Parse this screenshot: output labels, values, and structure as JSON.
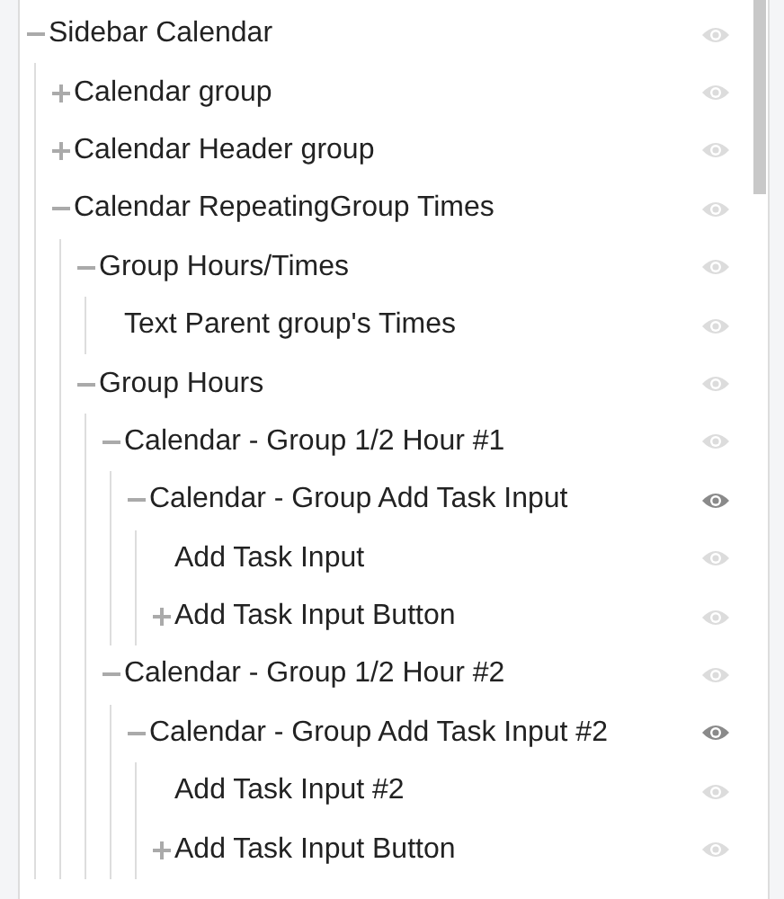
{
  "tree": [
    {
      "label": "Sidebar Calendar",
      "expanded": true,
      "eye_dark": false,
      "children": [
        {
          "label": "Calendar group",
          "expanded": false,
          "eye_dark": false
        },
        {
          "label": "Calendar Header group",
          "expanded": false,
          "eye_dark": false
        },
        {
          "label": "Calendar RepeatingGroup Times",
          "expanded": true,
          "eye_dark": false,
          "children": [
            {
              "label": "Group Hours/Times",
              "expanded": true,
              "eye_dark": false,
              "children": [
                {
                  "label": "Text Parent group's Times",
                  "eye_dark": false
                }
              ]
            },
            {
              "label": "Group Hours",
              "expanded": true,
              "eye_dark": false,
              "children": [
                {
                  "label": "Calendar - Group 1/2 Hour #1",
                  "expanded": true,
                  "eye_dark": false,
                  "children": [
                    {
                      "label": "Calendar - Group Add Task Input",
                      "expanded": true,
                      "eye_dark": true,
                      "children": [
                        {
                          "label": "Add Task Input",
                          "eye_dark": false
                        },
                        {
                          "label": "Add Task Input Button",
                          "expanded": false,
                          "eye_dark": false
                        }
                      ]
                    }
                  ]
                },
                {
                  "label": "Calendar - Group 1/2 Hour #2",
                  "expanded": true,
                  "eye_dark": false,
                  "children": [
                    {
                      "label": "Calendar - Group Add Task Input #2",
                      "expanded": true,
                      "eye_dark": true,
                      "children": [
                        {
                          "label": "Add Task Input #2",
                          "eye_dark": false
                        },
                        {
                          "label": "Add Task Input Button",
                          "expanded": false,
                          "eye_dark": false
                        }
                      ]
                    }
                  ]
                }
              ]
            }
          ]
        }
      ]
    }
  ]
}
